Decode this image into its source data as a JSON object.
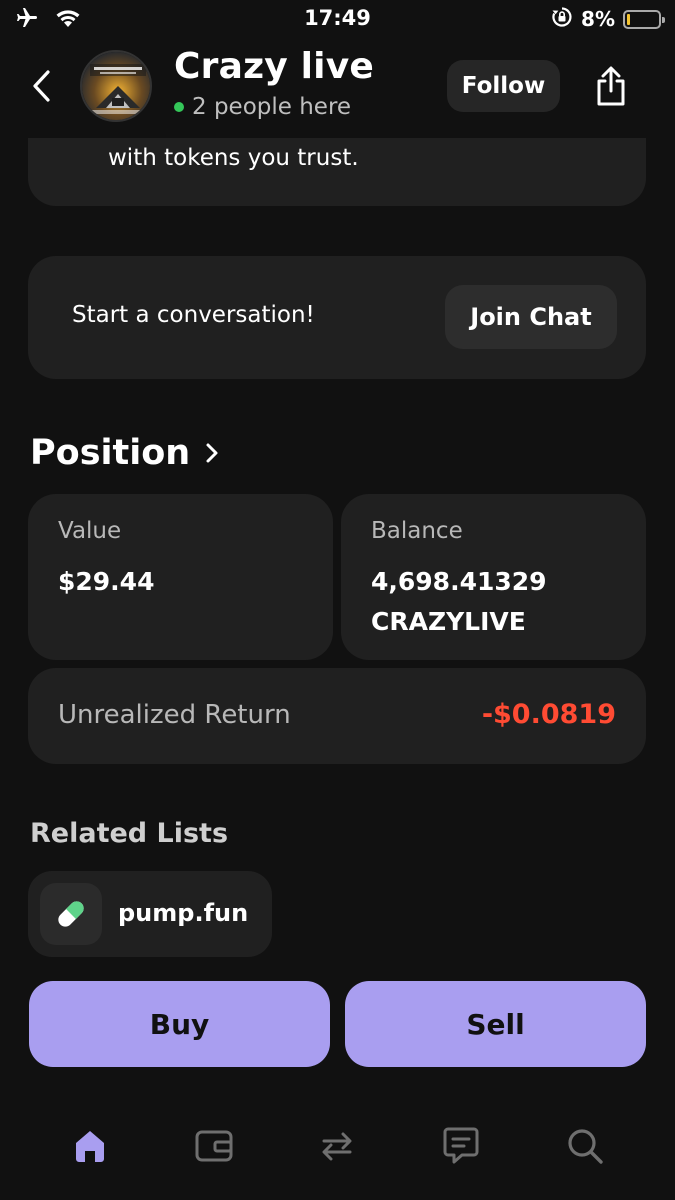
{
  "status_bar": {
    "time": "17:49",
    "battery_percent": "8%",
    "battery_level": 0.08,
    "battery_color": "#f4c430",
    "icons": [
      "airplane-icon",
      "wifi-icon",
      "orientation-lock-icon",
      "battery-icon"
    ]
  },
  "header": {
    "title": "Crazy live",
    "subtitle": "2 people here",
    "follow_label": "Follow",
    "online_color": "#34c759"
  },
  "about": {
    "text": "with tokens you trust."
  },
  "conversation": {
    "prompt": "Start a conversation!",
    "join_label": "Join Chat"
  },
  "position": {
    "title": "Position",
    "value_label": "Value",
    "value": "$29.44",
    "balance_label": "Balance",
    "balance_amount": "4,698.41329",
    "balance_symbol": "CRAZYLIVE",
    "unrealized_label": "Unrealized Return",
    "unrealized_value": "-$0.0819",
    "negative_color": "#ff4b33"
  },
  "related": {
    "title": "Related Lists",
    "items": [
      {
        "name": "pump.fun",
        "icon": "pill-icon"
      }
    ]
  },
  "actions": {
    "buy_label": "Buy",
    "sell_label": "Sell",
    "accent": "#a99ef0"
  },
  "bottom_nav": {
    "active": "home",
    "active_color": "#a99ef0",
    "items": [
      "home-icon",
      "wallet-icon",
      "swap-icon",
      "chat-icon",
      "search-icon"
    ]
  }
}
